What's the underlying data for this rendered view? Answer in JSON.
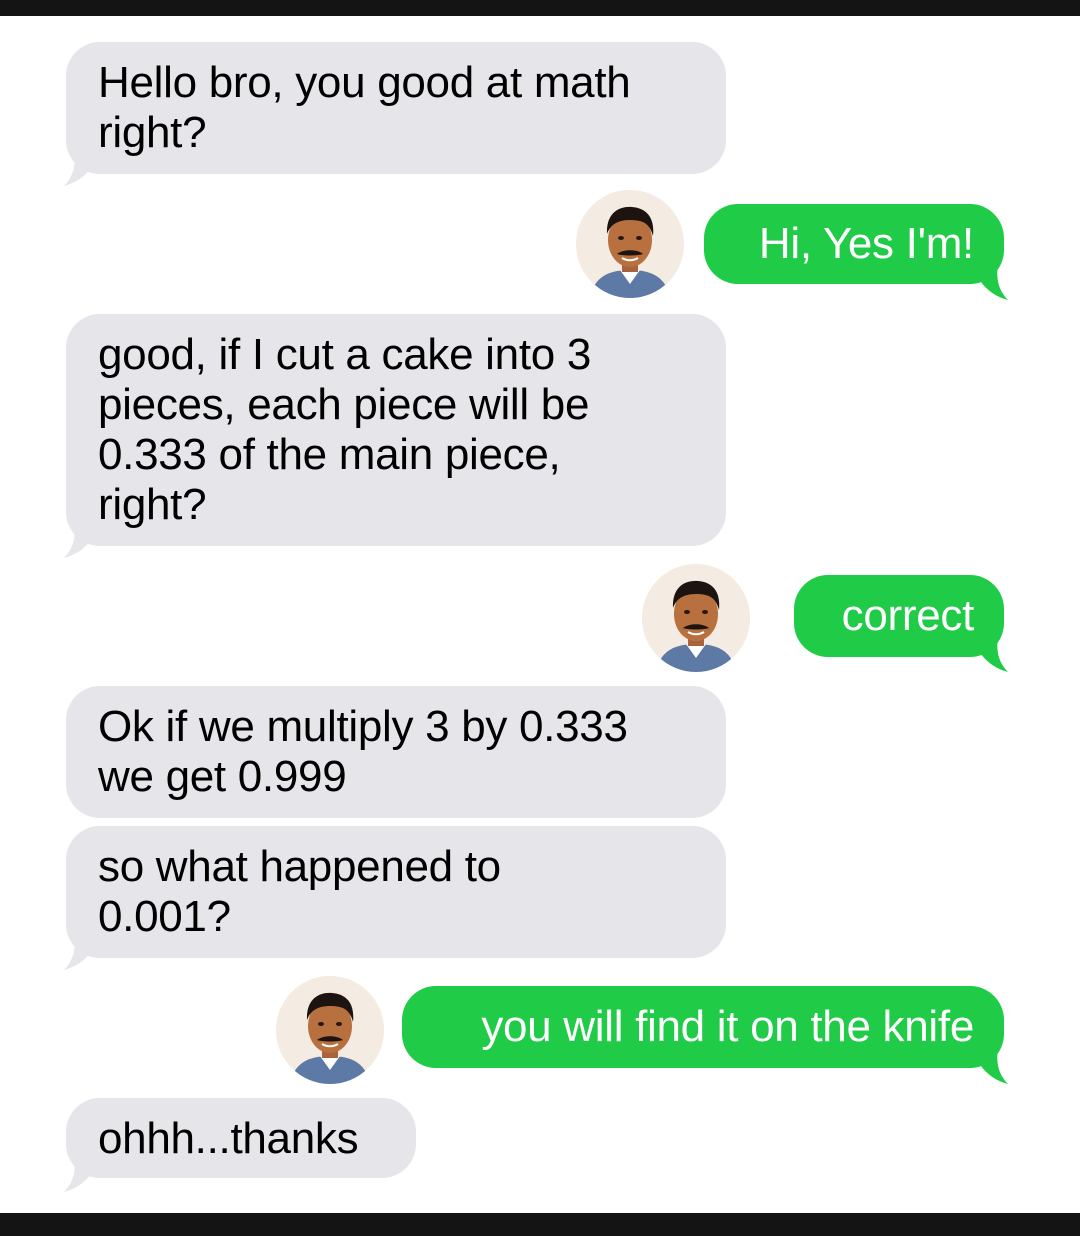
{
  "colors": {
    "incoming_bubble": "#e5e5ea",
    "outgoing_bubble": "#1fcb47",
    "outgoing_text": "#ffffff",
    "incoming_text": "#000000"
  },
  "messages": [
    {
      "sender": "them",
      "text": "Hello bro, you good at math\nright?"
    },
    {
      "sender": "me",
      "text": "Hi, Yes I'm!",
      "avatar": "man-avatar"
    },
    {
      "sender": "them",
      "text": "good, if I cut a cake into 3\npieces, each piece will be\n0.333 of the main piece,\nright?"
    },
    {
      "sender": "me",
      "text": "correct",
      "avatar": "man-avatar"
    },
    {
      "sender": "them",
      "text": "Ok if we multiply 3 by 0.333\nwe get 0.999"
    },
    {
      "sender": "them",
      "text": "so what happened to\n0.001?"
    },
    {
      "sender": "me",
      "text": "you will find it on the knife",
      "avatar": "man-avatar"
    },
    {
      "sender": "them",
      "text": "ohhh...thanks"
    }
  ]
}
